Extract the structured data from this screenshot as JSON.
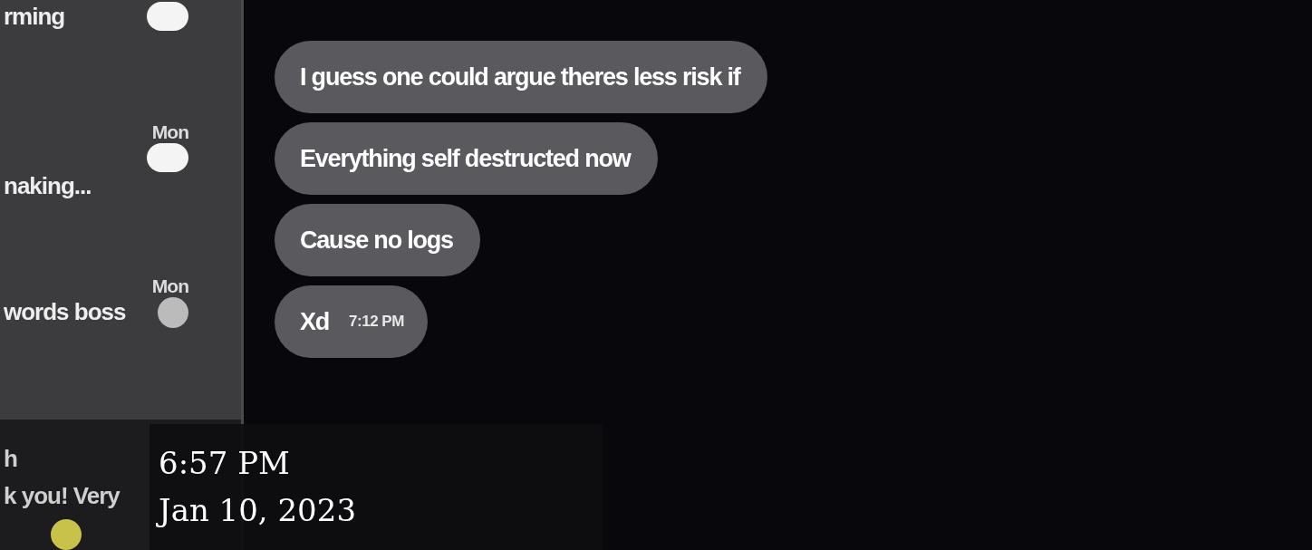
{
  "sidebar": {
    "conversations": [
      {
        "preview": "rming",
        "unread": true,
        "emoji": false
      },
      {
        "time": "Mon",
        "preview": "naking...",
        "unread": true,
        "emoji": false
      },
      {
        "time": "Mon",
        "preview": "words boss",
        "unread": false,
        "emoji": true
      },
      {
        "name": "h",
        "preview": "k you! Very",
        "unread": false,
        "emoji": true
      }
    ]
  },
  "messages": [
    {
      "text": "I guess one could argue theres less risk if"
    },
    {
      "text": "Everything self destructed now"
    },
    {
      "text": "Cause no logs"
    },
    {
      "text": "Xd",
      "time": "7:12 PM"
    }
  ],
  "caption": {
    "time": "6:57 PM",
    "date": "Jan 10, 2023"
  }
}
